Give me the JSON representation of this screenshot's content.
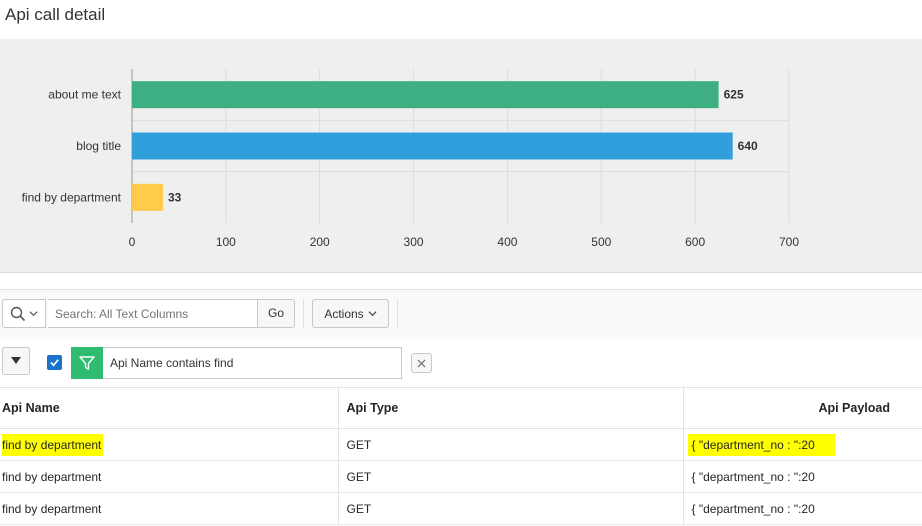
{
  "page": {
    "title": "Api call detail"
  },
  "chart_data": {
    "type": "bar",
    "orientation": "horizontal",
    "categories": [
      "about me text",
      "blog title",
      "find by department"
    ],
    "values": [
      625,
      640,
      33
    ],
    "data_labels": [
      "625",
      "640",
      "33"
    ],
    "colors": [
      "#3daf82",
      "#309fdb",
      "#fecb4a"
    ],
    "xlim": [
      0,
      700
    ],
    "xticks": [
      0,
      100,
      200,
      300,
      400,
      500,
      600,
      700
    ],
    "xtick_labels": [
      "0",
      "100",
      "200",
      "300",
      "400",
      "500",
      "600",
      "700"
    ],
    "grid": true
  },
  "toolbar": {
    "search_placeholder": "Search: All Text Columns",
    "go_label": "Go",
    "actions_label": "Actions"
  },
  "filter": {
    "enabled": true,
    "text": "Api Name contains find"
  },
  "table": {
    "headers": {
      "name": "Api Name",
      "type": "Api Type",
      "payload": "Api Payload"
    },
    "rows": [
      {
        "name": "find by department",
        "type": "GET",
        "payload": "{ \"department_no : \":20"
      },
      {
        "name": "find by department",
        "type": "GET",
        "payload": "{ \"department_no : \":20"
      },
      {
        "name": "find by department",
        "type": "GET",
        "payload": "{ \"department_no : \":20"
      }
    ]
  },
  "colors": {
    "filter_green": "#2ebd70",
    "checkbox_blue": "#1a73c8",
    "highlight": "#ffff00"
  }
}
